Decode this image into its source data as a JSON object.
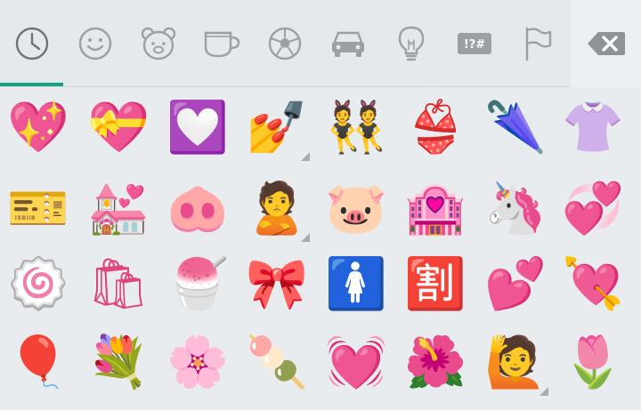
{
  "tabs": [
    {
      "name": "recent-icon",
      "active": true
    },
    {
      "name": "smiley-icon",
      "active": false
    },
    {
      "name": "bear-icon",
      "active": false
    },
    {
      "name": "cup-icon",
      "active": false
    },
    {
      "name": "soccer-ball-icon",
      "active": false
    },
    {
      "name": "car-icon",
      "active": false
    },
    {
      "name": "lightbulb-icon",
      "active": false
    },
    {
      "name": "symbols-icon",
      "label": "!?#",
      "active": false
    },
    {
      "name": "flag-icon",
      "active": false
    }
  ],
  "backspace": {
    "name": "backspace-icon"
  },
  "colors": {
    "accent": "#16a085",
    "icon": "#9aa0a4"
  },
  "emoji_rows": [
    [
      "💖",
      "💝",
      "💟",
      "💅",
      "👯",
      "👙",
      "🌂",
      "👚"
    ],
    [
      "🎫",
      "💒",
      "🐽",
      "🙎",
      "🐷",
      "🏩",
      "🦄",
      "💞"
    ],
    [
      "🍥",
      "🛍",
      "🍧",
      "🎀",
      "🚺",
      "🈹",
      "💕",
      "💘"
    ],
    [
      "🎈",
      "💐",
      "🌸",
      "🍡",
      "💓",
      "🌺",
      "🙋",
      "🌷"
    ]
  ],
  "variant_cells": [
    [
      0,
      3
    ],
    [
      1,
      3
    ],
    [
      3,
      6
    ]
  ]
}
